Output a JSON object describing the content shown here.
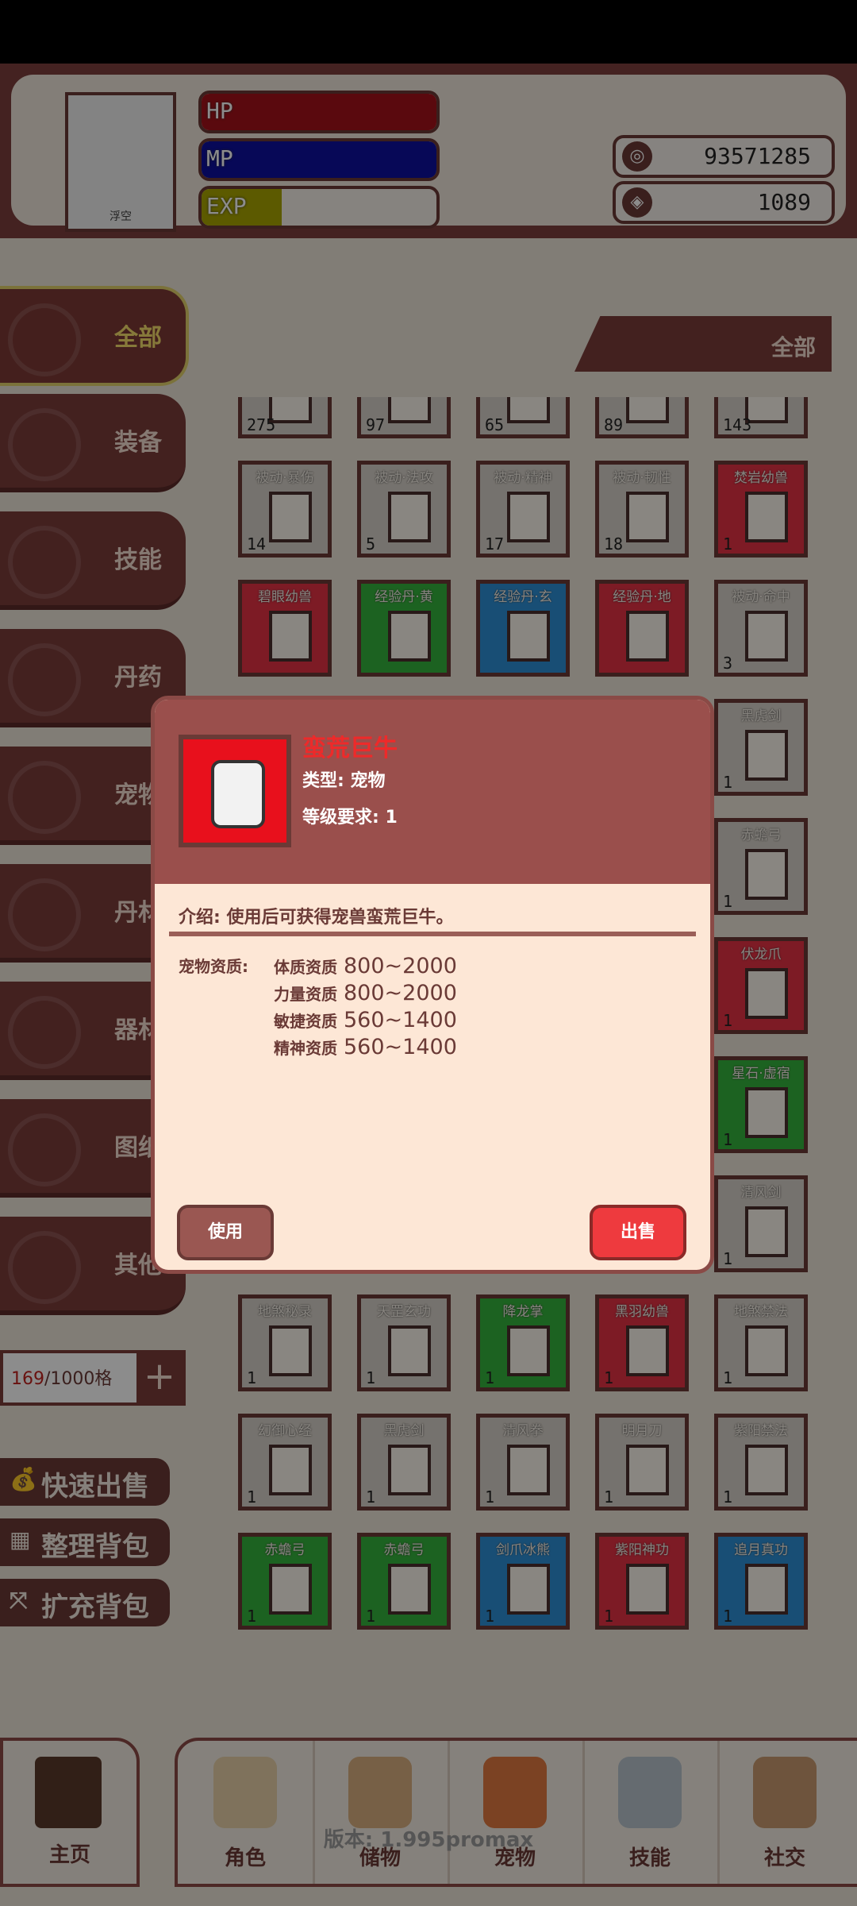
{
  "header": {
    "player_name": "浮空",
    "bars": {
      "hp_label": "HP",
      "mp_label": "MP",
      "exp_label": "EXP",
      "exp_fraction": 0.34
    },
    "coins": "93571285",
    "gems": "1089"
  },
  "sidebar": {
    "items": [
      {
        "label": "全部"
      },
      {
        "label": "装备"
      },
      {
        "label": "技能"
      },
      {
        "label": "丹药"
      },
      {
        "label": "宠物"
      },
      {
        "label": "丹材"
      },
      {
        "label": "器材"
      },
      {
        "label": "图纸"
      },
      {
        "label": "其他"
      }
    ],
    "capacity_used": "169",
    "capacity_total": "/1000格",
    "capacity_add": "+",
    "actions": [
      {
        "icon": "💰",
        "label": "快速出售"
      },
      {
        "icon": "▦",
        "label": "整理背包"
      },
      {
        "icon": "⤧",
        "label": "扩充背包"
      }
    ]
  },
  "filter": {
    "label": "全部"
  },
  "inventory": [
    {
      "name": "",
      "count": "275",
      "color": "#d6d0c8"
    },
    {
      "name": "",
      "count": "97",
      "color": "#d6d0c8"
    },
    {
      "name": "",
      "count": "65",
      "color": "#d6d0c8"
    },
    {
      "name": "",
      "count": "89",
      "color": "#d6d0c8"
    },
    {
      "name": "",
      "count": "143",
      "color": "#d6d0c8"
    },
    {
      "name": "被动·暴伤",
      "count": "14",
      "color": "#d6d0c8"
    },
    {
      "name": "被动·法攻",
      "count": "5",
      "color": "#d6d0c8"
    },
    {
      "name": "被动·精神",
      "count": "17",
      "color": "#d6d0c8"
    },
    {
      "name": "被动·韧性",
      "count": "18",
      "color": "#d6d0c8"
    },
    {
      "name": "焚岩幼兽",
      "count": "1",
      "color": "#e33244"
    },
    {
      "name": "碧眼幼兽",
      "count": "",
      "color": "#e33244"
    },
    {
      "name": "经验丹·黄",
      "count": "",
      "color": "#34b23c"
    },
    {
      "name": "经验丹·玄",
      "count": "",
      "color": "#2d8fd6"
    },
    {
      "name": "经验丹·地",
      "count": "",
      "color": "#e33244"
    },
    {
      "name": "被动·命中",
      "count": "3",
      "color": "#d6d0c8"
    },
    {
      "name": "黑虎剑",
      "count": "1",
      "color": "#d6d0c8"
    },
    {
      "name": "赤蟾弓",
      "count": "1",
      "color": "#d6d0c8"
    },
    {
      "name": "伏龙爪",
      "count": "1",
      "color": "#e33244"
    },
    {
      "name": "星石·虚宿",
      "count": "1",
      "color": "#34b23c"
    },
    {
      "name": "清风剑",
      "count": "1",
      "color": "#d6d0c8"
    },
    {
      "name": "地煞秘录",
      "count": "1",
      "color": "#d6d0c8"
    },
    {
      "name": "天罡玄功",
      "count": "1",
      "color": "#d6d0c8"
    },
    {
      "name": "降龙掌",
      "count": "1",
      "color": "#34b23c"
    },
    {
      "name": "黑羽幼兽",
      "count": "1",
      "color": "#e33244"
    },
    {
      "name": "地煞禁法",
      "count": "1",
      "color": "#d6d0c8"
    },
    {
      "name": "幻御心经",
      "count": "1",
      "color": "#d6d0c8"
    },
    {
      "name": "黑虎剑",
      "count": "1",
      "color": "#d6d0c8"
    },
    {
      "name": "清风拳",
      "count": "1",
      "color": "#d6d0c8"
    },
    {
      "name": "明月刀",
      "count": "1",
      "color": "#d6d0c8"
    },
    {
      "name": "紫阳禁法",
      "count": "1",
      "color": "#d6d0c8"
    },
    {
      "name": "赤蟾弓",
      "count": "1",
      "color": "#34b23c"
    },
    {
      "name": "赤蟾弓",
      "count": "1",
      "color": "#34b23c"
    },
    {
      "name": "剑爪冰熊",
      "count": "1",
      "color": "#2d8fd6"
    },
    {
      "name": "紫阳神功",
      "count": "1",
      "color": "#e33244"
    },
    {
      "name": "追月真功",
      "count": "1",
      "color": "#2d8fd6"
    }
  ],
  "popup": {
    "item_name": "蛮荒巨牛",
    "type": "类型: 宠物",
    "level_req": "等级要求: 1",
    "description": "介绍: 使用后可获得宠兽蛮荒巨牛。",
    "stats_label": "宠物资质:",
    "stats": [
      {
        "name": "体质资质",
        "value": "800~2000"
      },
      {
        "name": "力量资质",
        "value": "800~2000"
      },
      {
        "name": "敏捷资质",
        "value": "560~1400"
      },
      {
        "name": "精神资质",
        "value": "560~1400"
      }
    ],
    "use_label": "使用",
    "sell_label": "出售"
  },
  "nav": {
    "home_label": "主页",
    "items": [
      {
        "label": "角色"
      },
      {
        "label": "储物"
      },
      {
        "label": "宠物"
      },
      {
        "label": "技能"
      },
      {
        "label": "社交"
      }
    ]
  },
  "version": "版本: 1.995promax"
}
